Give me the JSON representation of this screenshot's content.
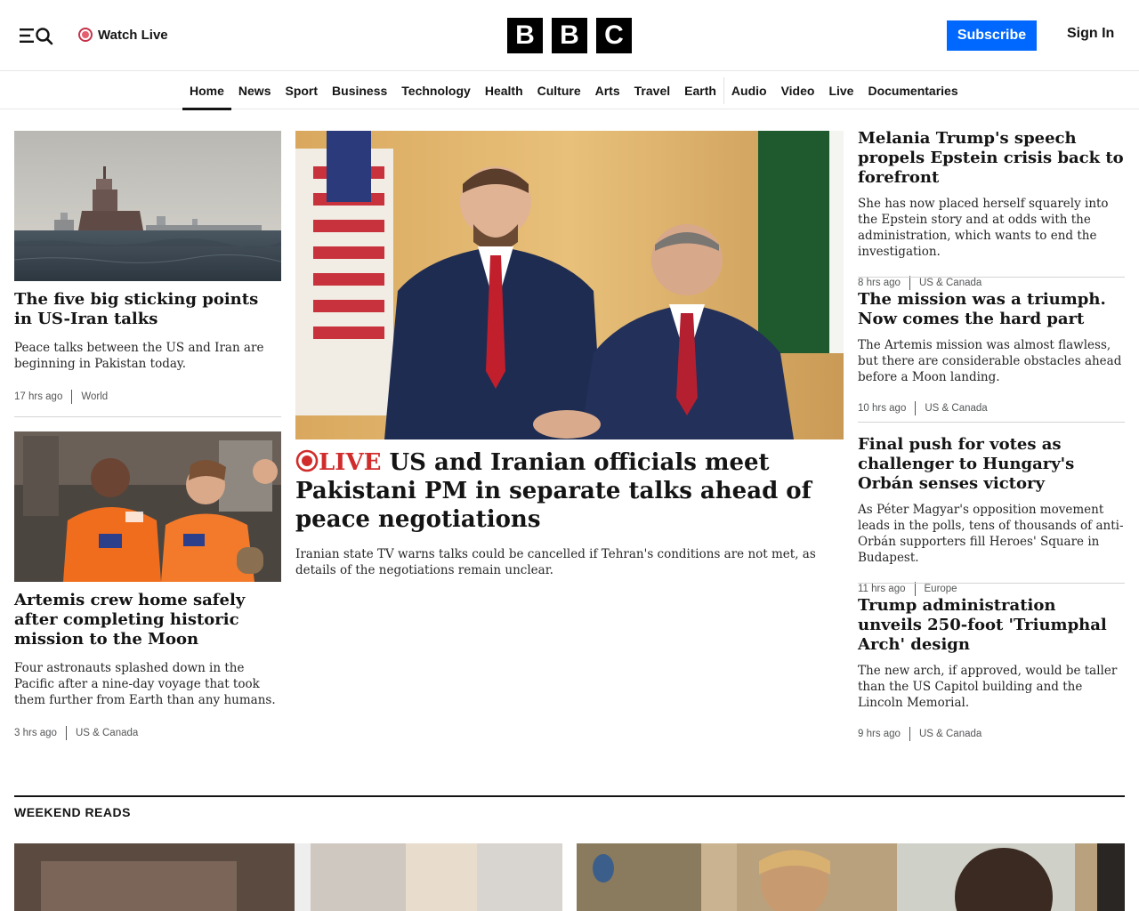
{
  "header": {
    "watch_live": "Watch Live",
    "logo_letters": [
      "B",
      "B",
      "C"
    ],
    "subscribe": "Subscribe",
    "sign_in": "Sign In"
  },
  "nav": {
    "items": [
      "Home",
      "News",
      "Sport",
      "Business",
      "Technology",
      "Health",
      "Culture",
      "Arts",
      "Travel",
      "Earth",
      "Audio",
      "Video",
      "Live",
      "Documentaries"
    ],
    "active": "Home"
  },
  "stories": {
    "left1": {
      "image": "oil-tanker-at-sea-photo",
      "headline": "The five big sticking points in US-Iran talks",
      "summary": "Peace talks between the US and Iran are beginning in Pakistan today.",
      "time": "17 hrs ago",
      "section": "World"
    },
    "left2": {
      "image": "artemis-astronauts-photo",
      "headline": "Artemis crew home safely after completing historic mission to the Moon",
      "summary": "Four astronauts splashed down in the Pacific after a nine-day voyage that took them further from Earth than any humans.",
      "time": "3 hrs ago",
      "section": "US & Canada"
    },
    "lead": {
      "image": "vance-sharif-handshake-photo",
      "live_label": "LIVE",
      "headline": "US and Iranian officials meet Pakistani PM in separate talks ahead of peace negotiations",
      "summary": "Iranian state TV warns talks could be cancelled if Tehran's conditions are not met, as details of the negotiations remain unclear."
    },
    "right1": {
      "headline": "Melania Trump's speech propels Epstein crisis back to forefront",
      "summary": "She has now placed herself squarely into the Epstein story and at odds with the administration, which wants to end the investigation.",
      "time": "8 hrs ago",
      "section": "US & Canada"
    },
    "right2": {
      "headline": "The mission was a triumph. Now comes the hard part",
      "summary": "The Artemis mission was almost flawless, but there are considerable obstacles ahead before a Moon landing.",
      "time": "10 hrs ago",
      "section": "US & Canada"
    },
    "right3": {
      "headline": "Final push for votes as challenger to Hungary's Orbán senses victory",
      "summary": "As Péter Magyar's opposition movement leads in the polls, tens of thousands of anti-Orbán supporters fill Heroes' Square in Budapest.",
      "time": "11 hrs ago",
      "section": "Europe"
    },
    "right4": {
      "headline": "Trump administration unveils 250-foot 'Triumphal Arch' design",
      "summary": "The new arch, if approved, would be taller than the US Capitol building and the Lincoln Memorial.",
      "time": "9 hrs ago",
      "section": "US & Canada"
    }
  },
  "weekend": {
    "title": "WEEKEND READS",
    "images": [
      "weekend-read-image-1",
      "weekend-read-image-2"
    ]
  },
  "colors": {
    "brand_black": "#000000",
    "subscribe_blue": "#0068ff",
    "live_red": "#d12c2c"
  }
}
